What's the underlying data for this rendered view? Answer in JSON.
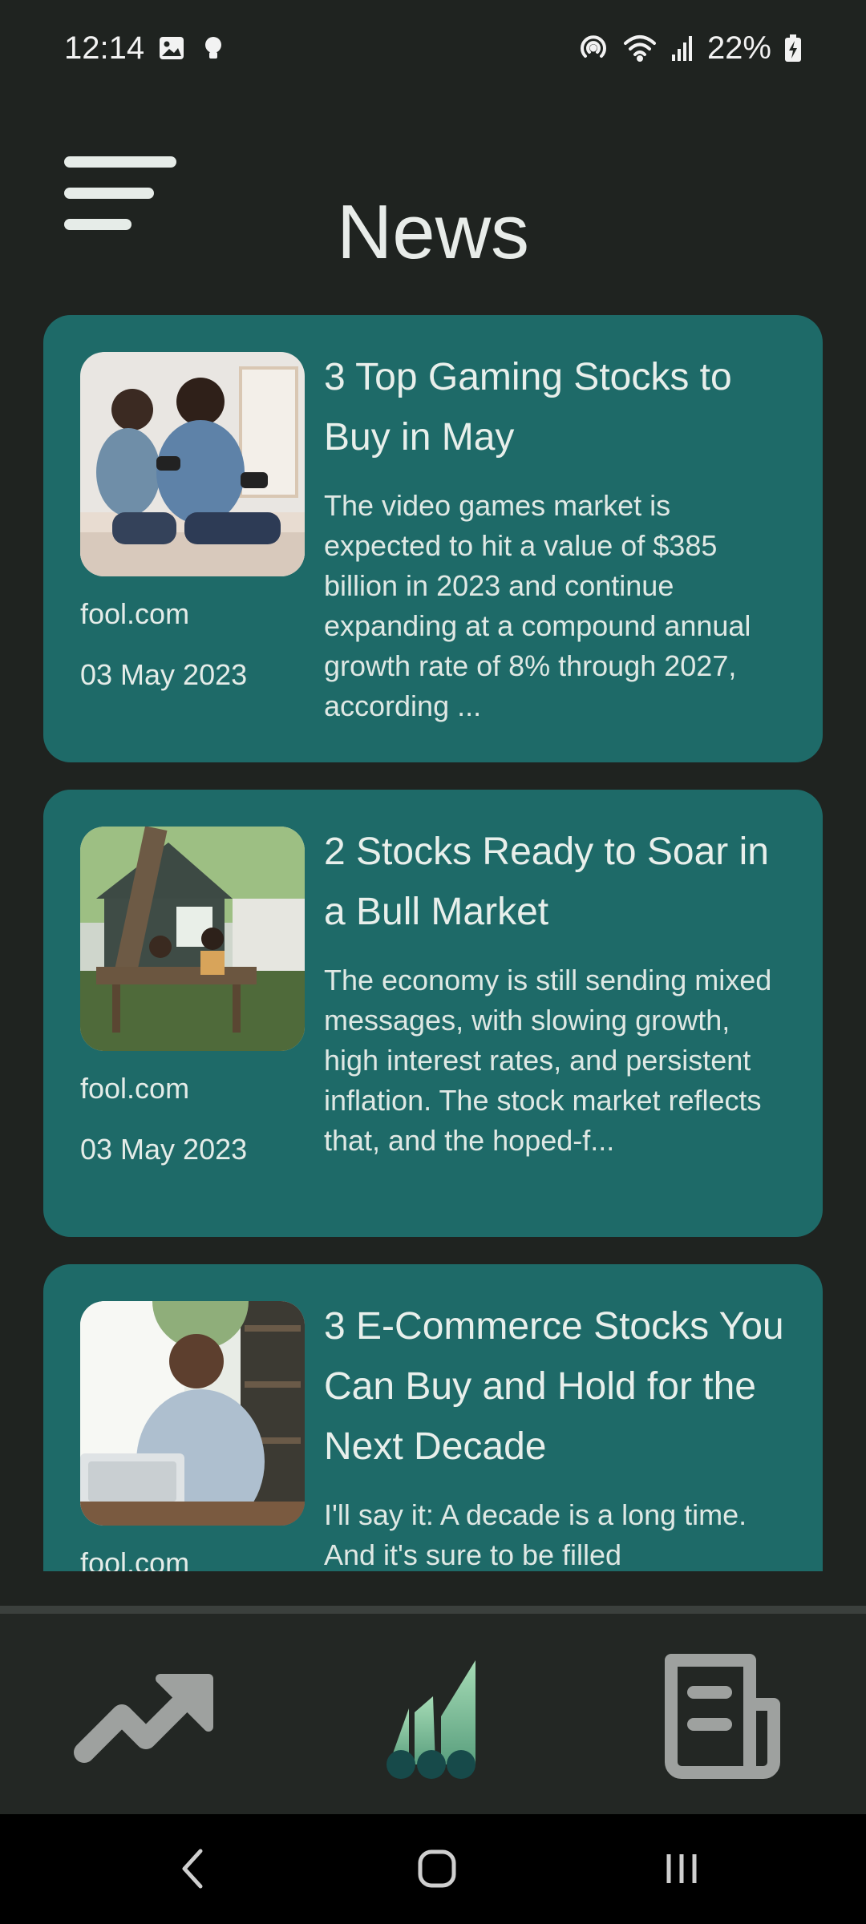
{
  "status_bar": {
    "time": "12:14",
    "battery": "22%",
    "icons": [
      "image-icon",
      "lightbulb-icon",
      "hotspot-icon",
      "wifi-icon",
      "signal-icon",
      "battery-charging-icon"
    ]
  },
  "header": {
    "menu_icon": "hamburger-menu-icon",
    "title": "News"
  },
  "articles": [
    {
      "headline": "3 Top Gaming Stocks to Buy in May",
      "summary": "The video games market is expected to hit a value of $385 billion in 2023 and continue expanding at a compound annual growth rate of 8% through 2027, according ...",
      "source": "fool.com",
      "date": "03 May 2023"
    },
    {
      "headline": "2 Stocks Ready to Soar in a Bull Market",
      "summary": "The economy is still sending mixed messages, with slowing growth, high interest rates, and persistent inflation. The stock market reflects that, and the hoped-f...",
      "source": "fool.com",
      "date": "03 May 2023"
    },
    {
      "headline": "3 E-Commerce Stocks You Can Buy and Hold for the Next Decade",
      "summary": "I'll say it: A decade is a long time. And it's sure to be filled",
      "source": "fool.com",
      "date": ""
    }
  ],
  "bottom_nav": {
    "items": [
      {
        "icon": "trending-up-icon",
        "active": false
      },
      {
        "icon": "bar-chart-icon",
        "active": true
      },
      {
        "icon": "newspaper-icon",
        "active": false
      }
    ]
  },
  "system_nav": {
    "items": [
      "back-icon",
      "home-icon",
      "recents-icon"
    ]
  },
  "colors": {
    "background": "#1f2320",
    "card": "#1e6a68",
    "nav_background": "#232724",
    "accent": "#86c9a3",
    "inactive_icon": "#9ea19f"
  }
}
